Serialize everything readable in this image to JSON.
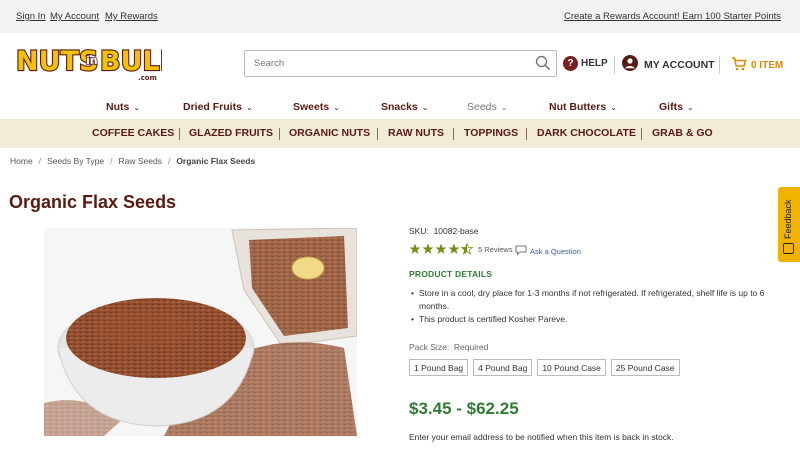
{
  "topbar": {
    "sign_in": "Sign In",
    "my_account": "My Account",
    "my_rewards": "My Rewards",
    "promo": "Create a Rewards Account! Earn 100 Starter Points"
  },
  "logo": {
    "text": "NUTS",
    "mid": "in",
    "text2": "BULK",
    "suffix": ".com"
  },
  "search": {
    "placeholder": "Search"
  },
  "header": {
    "help": "HELP",
    "help_glyph": "?",
    "account": "MY ACCOUNT",
    "cart": "0 ITEM"
  },
  "nav": {
    "items": [
      {
        "label": "Nuts"
      },
      {
        "label": "Dried Fruits"
      },
      {
        "label": "Sweets"
      },
      {
        "label": "Snacks"
      },
      {
        "label": "Seeds"
      },
      {
        "label": "Nut Butters"
      },
      {
        "label": "Gifts"
      }
    ]
  },
  "subnav": {
    "items": [
      {
        "label": "COFFEE CAKES"
      },
      {
        "label": "GLAZED FRUITS"
      },
      {
        "label": "ORGANIC NUTS"
      },
      {
        "label": "RAW NUTS"
      },
      {
        "label": "TOPPINGS"
      },
      {
        "label": "DARK CHOCOLATE"
      },
      {
        "label": "GRAB & GO"
      }
    ]
  },
  "breadcrumb": {
    "items": [
      "Home",
      "Seeds By Type",
      "Raw Seeds",
      "Organic Flax Seeds"
    ]
  },
  "product": {
    "title": "Organic Flax Seeds",
    "sku_label": "SKU:",
    "sku": "10082-base",
    "rating": 4.5,
    "reviews": "5 Reviews",
    "ask": "Ask a Question",
    "details_heading": "PRODUCT DETAILS",
    "details": [
      "Store in a cool, dry place for 1-3 months if not refrigerated. If refrigerated, shelf life is up to 6 months.",
      "This product is certified Kosher Pareve."
    ],
    "pack_size_label": "Pack Size:",
    "pack_size_required": "Required",
    "options": [
      "1 Pound Bag",
      "4 Pound Bag",
      "10 Pound Case",
      "25 Pound Case"
    ],
    "price": "$3.45 - $62.25",
    "notify": "Enter your email address to be notified when this item is back in stock."
  },
  "feedback": {
    "label": "Feedback"
  },
  "colors": {
    "brand_maroon": "#5a1a12",
    "price_green": "#2e7d32",
    "cart_orange": "#d98a00",
    "subnav_bg": "#f2ebd8",
    "feedback_yellow": "#f0b400"
  }
}
